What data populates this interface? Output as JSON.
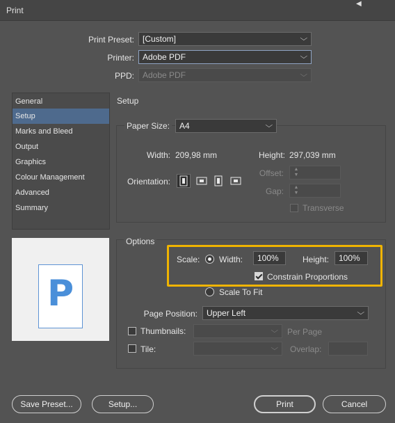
{
  "window": {
    "title": "Print"
  },
  "preset": {
    "print_preset_label": "Print Preset:",
    "print_preset_value": "[Custom]",
    "printer_label": "Printer:",
    "printer_value": "Adobe PDF",
    "ppd_label": "PPD:",
    "ppd_value": "Adobe PDF"
  },
  "sidebar": {
    "items": [
      {
        "label": "General",
        "selected": false
      },
      {
        "label": "Setup",
        "selected": true
      },
      {
        "label": "Marks and Bleed",
        "selected": false
      },
      {
        "label": "Output",
        "selected": false
      },
      {
        "label": "Graphics",
        "selected": false
      },
      {
        "label": "Colour Management",
        "selected": false
      },
      {
        "label": "Advanced",
        "selected": false
      },
      {
        "label": "Summary",
        "selected": false
      }
    ]
  },
  "preview": {
    "letter": "P"
  },
  "setup": {
    "heading": "Setup",
    "paper_size_label": "Paper Size:",
    "paper_size_value": "A4",
    "width_label": "Width:",
    "width_value": "209,98 mm",
    "height_label": "Height:",
    "height_value": "297,039 mm",
    "orientation_label": "Orientation:",
    "orientation_options": [
      "portrait-icon",
      "landscape-icon",
      "reverse-portrait-icon",
      "reverse-landscape-icon"
    ],
    "orientation_selected": 0,
    "offset_label": "Offset:",
    "gap_label": "Gap:",
    "transverse_label": "Transverse"
  },
  "options": {
    "heading": "Options",
    "scale_label": "Scale:",
    "width_radio_label": "Width:",
    "width_value": "100%",
    "height_label": "Height:",
    "height_value": "100%",
    "constrain_label": "Constrain Proportions",
    "constrain_checked": true,
    "scale_to_fit_label": "Scale To Fit",
    "page_position_label": "Page Position:",
    "page_position_value": "Upper Left",
    "thumbnails_label": "Thumbnails:",
    "per_page_label": "Per Page",
    "tile_label": "Tile:",
    "overlap_label": "Overlap:"
  },
  "buttons": {
    "save_preset": "Save Preset...",
    "setup": "Setup...",
    "print": "Print",
    "cancel": "Cancel"
  },
  "colors": {
    "background": "#535353",
    "selection": "#4e6a8d",
    "highlight": "#f0b400"
  }
}
